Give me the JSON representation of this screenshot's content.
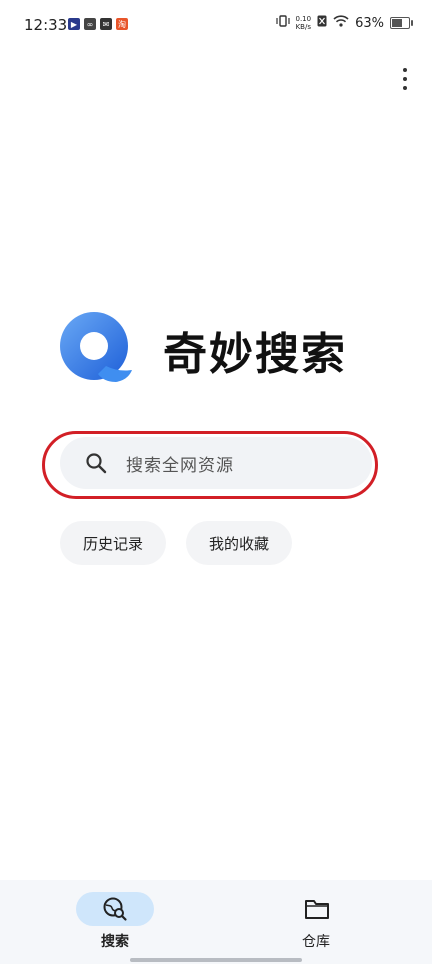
{
  "status_bar": {
    "time": "12:33",
    "net_speed_value": "0.10",
    "net_speed_unit": "KB/s",
    "battery": "63%",
    "battery_level": 0.63
  },
  "app": {
    "title": "奇妙搜索",
    "logo_colors": {
      "primary": "#3f8ef0",
      "accent": "#1e5fd8",
      "light": "#6aa9f5"
    }
  },
  "search": {
    "placeholder": "搜索全网资源",
    "highlight_color": "#d21f26"
  },
  "quick_actions": [
    {
      "label": "历史记录"
    },
    {
      "label": "我的收藏"
    }
  ],
  "bottom_nav": [
    {
      "label": "搜索",
      "icon": "search-globe-icon",
      "active": true
    },
    {
      "label": "仓库",
      "icon": "folder-icon",
      "active": false
    }
  ]
}
